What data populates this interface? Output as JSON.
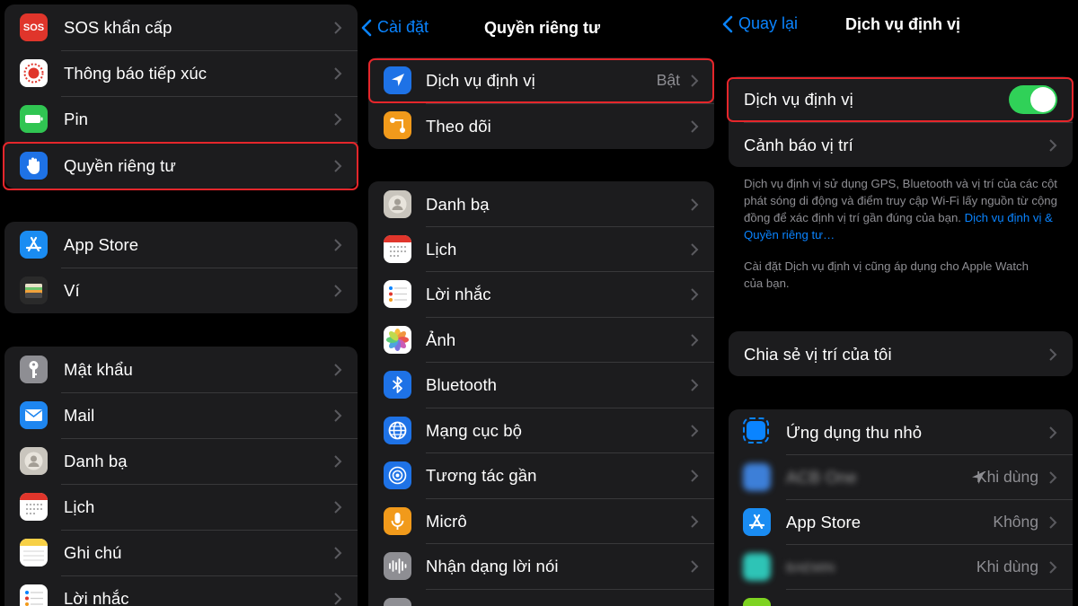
{
  "panel1": {
    "group1": [
      {
        "icon": "sos-icon",
        "label": "SOS khẩn cấp",
        "icon_text": "SOS",
        "color": "#e0352b"
      },
      {
        "icon": "exposure-notification-icon",
        "label": "Thông báo tiếp xúc",
        "color": "#ffffff"
      },
      {
        "icon": "battery-icon",
        "label": "Pin",
        "color": "#30c552"
      },
      {
        "icon": "privacy-hand-icon",
        "label": "Quyền riêng tư",
        "color": "#1e72e6"
      }
    ],
    "group2": [
      {
        "icon": "app-store-icon",
        "label": "App Store",
        "color": "#1a8cf2"
      },
      {
        "icon": "wallet-icon",
        "label": "Ví",
        "color": "#2a2a2a"
      }
    ],
    "group3": [
      {
        "icon": "key-icon",
        "label": "Mật khẩu",
        "color": "#8e8e93"
      },
      {
        "icon": "mail-icon",
        "label": "Mail",
        "color": "#1e86f0"
      },
      {
        "icon": "contacts-icon",
        "label": "Danh bạ",
        "color": "#c9c5bd"
      },
      {
        "icon": "calendar-icon",
        "label": "Lịch",
        "color": "#ffffff"
      },
      {
        "icon": "notes-icon",
        "label": "Ghi chú",
        "color": "#ffffff"
      },
      {
        "icon": "reminders-icon",
        "label": "Lời nhắc",
        "color": "#ffffff"
      }
    ]
  },
  "panel2": {
    "back_label": "Cài đặt",
    "title": "Quyền riêng tư",
    "group1": [
      {
        "icon": "location-arrow-icon",
        "label": "Dịch vụ định vị",
        "value": "Bật",
        "color": "#1e72e6"
      },
      {
        "icon": "tracking-icon",
        "label": "Theo dõi",
        "color": "#f19a1b"
      }
    ],
    "group2": [
      {
        "icon": "contacts-icon",
        "label": "Danh bạ",
        "color": "#c9c5bd"
      },
      {
        "icon": "calendar-icon",
        "label": "Lịch",
        "color": "#ffffff"
      },
      {
        "icon": "reminders-icon",
        "label": "Lời nhắc",
        "color": "#ffffff"
      },
      {
        "icon": "photos-icon",
        "label": "Ảnh",
        "color": "#ffffff"
      },
      {
        "icon": "bluetooth-icon",
        "label": "Bluetooth",
        "color": "#1e72e6"
      },
      {
        "icon": "local-network-icon",
        "label": "Mạng cục bộ",
        "color": "#1e72e6"
      },
      {
        "icon": "nearby-interaction-icon",
        "label": "Tương tác gần",
        "color": "#1e72e6"
      },
      {
        "icon": "microphone-icon",
        "label": "Micrô",
        "color": "#f19a1b"
      },
      {
        "icon": "speech-recognition-icon",
        "label": "Nhận dạng lời nói",
        "color": "#8e8e93"
      }
    ]
  },
  "panel3": {
    "back_label": "Quay lại",
    "title": "Dịch vụ định vị",
    "toggle_label": "Dịch vụ định vị",
    "toggle_on": true,
    "alerts_label": "Cảnh báo vị trí",
    "note1_text": "Dịch vụ định vị sử dụng GPS, Bluetooth và vị trí của các cột phát sóng di động và điểm truy cập Wi-Fi lấy nguồn từ cộng đồng để xác định vị trí gần đúng của bạn.",
    "note1_link": "Dịch vụ định vị & Quyền riêng tư…",
    "note2_text": "Cài đặt Dịch vụ định vị cũng áp dụng cho Apple Watch của bạn.",
    "share_label": "Chia sẻ vị trí của tôi",
    "apps": [
      {
        "icon": "widgets-icon",
        "label": "Ứng dụng thu nhỏ",
        "value": "",
        "color": "#0a84ff"
      },
      {
        "icon": "acb-one-icon",
        "label": "ACB One",
        "value": "Khi dùng",
        "color": "#3d7fd8",
        "blurred": true,
        "arrow": true
      },
      {
        "icon": "app-store-icon",
        "label": "App Store",
        "value": "Không",
        "color": "#1a8cf2"
      },
      {
        "icon": "baemin-icon",
        "label": "BAEMIN",
        "value": "Khi dùng",
        "color": "#2ec4b6",
        "blurred": true
      }
    ]
  },
  "colors": {
    "highlight": "#e5262b",
    "accent": "#0a84ff",
    "toggle": "#30d158"
  }
}
